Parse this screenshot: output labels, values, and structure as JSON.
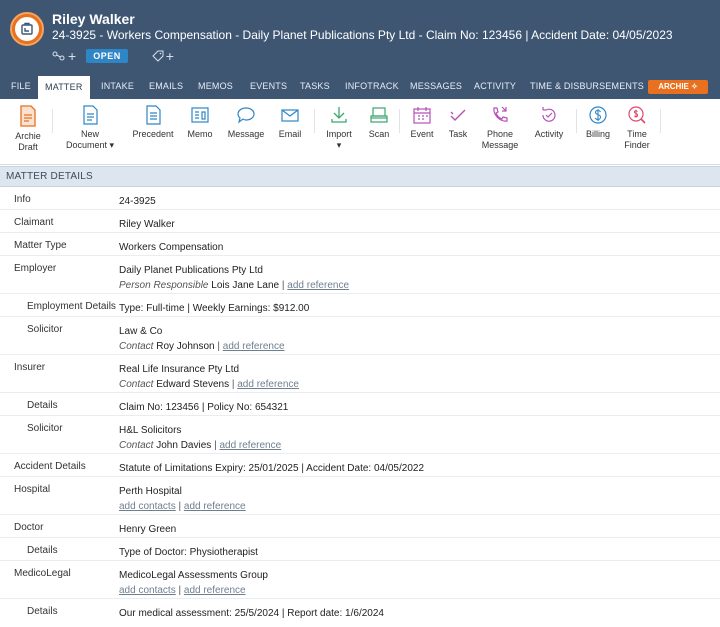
{
  "header": {
    "title": "Riley Walker",
    "subtitle": "24-3925 - Workers Compensation - Daily Planet Publications Pty Ltd - Claim No: 123456 | Accident Date: 04/05/2023",
    "status": "OPEN",
    "plus": "+"
  },
  "tabs": [
    "FILE",
    "MATTER",
    "INTAKE",
    "EMAILS",
    "MEMOS",
    "EVENTS",
    "TASKS",
    "INFOTRACK",
    "MESSAGES",
    "ACTIVITY",
    "TIME & DISBURSEMENTS"
  ],
  "archie_button": "ARCHIE ✧",
  "toolbar": {
    "archie_draft": [
      "Archie",
      "Draft"
    ],
    "new_document": [
      "New",
      "Document ▾"
    ],
    "precedent": "Precedent",
    "memo": "Memo",
    "message": "Message",
    "email": "Email",
    "import": [
      "Import",
      "▾"
    ],
    "scan": "Scan",
    "event": "Event",
    "task": "Task",
    "phone_message": [
      "Phone",
      "Message"
    ],
    "activity": "Activity",
    "billing": "Billing",
    "time_finder": [
      "Time",
      "Finder"
    ]
  },
  "section_title": "MATTER DETAILS",
  "links": {
    "add_reference": "add reference",
    "add_contacts": "add contacts"
  },
  "details": {
    "info_label": "Info",
    "info": "24-3925",
    "claimant_label": "Claimant",
    "claimant": "Riley Walker",
    "matter_type_label": "Matter Type",
    "matter_type": "Workers Compensation",
    "employer_label": "Employer",
    "employer": "Daily Planet Publications Pty Ltd",
    "person_responsible_label": "Person Responsible",
    "person_responsible": "Lois Jane Lane",
    "employment_details_label": "Employment Details",
    "employment_details": "Type: Full-time | Weekly Earnings: $912.00",
    "solicitor_label": "Solicitor",
    "emp_solicitor": "Law & Co",
    "contact_label": "Contact",
    "emp_solicitor_contact": "Roy Johnson",
    "insurer_label": "Insurer",
    "insurer": "Real Life Insurance Pty Ltd",
    "insurer_contact": "Edward Stevens",
    "details_label": "Details",
    "insurer_details": "Claim No: 123456 | Policy No: 654321",
    "ins_solicitor": "H&L Solicitors",
    "ins_solicitor_contact": "John Davies",
    "accident_details_label": "Accident Details",
    "accident_details": "Statute of Limitations Expiry: 25/01/2025 | Accident Date: 04/05/2022",
    "hospital_label": "Hospital",
    "hospital": "Perth Hospital",
    "doctor_label": "Doctor",
    "doctor": "Henry Green",
    "doctor_details": "Type of Doctor: Physiotherapist",
    "medicolegal_label": "MedicoLegal",
    "medicolegal": "MedicoLegal Assessments Group",
    "medicolegal_details": "Our medical assessment: 25/5/2024 | Report date: 1/6/2024"
  }
}
